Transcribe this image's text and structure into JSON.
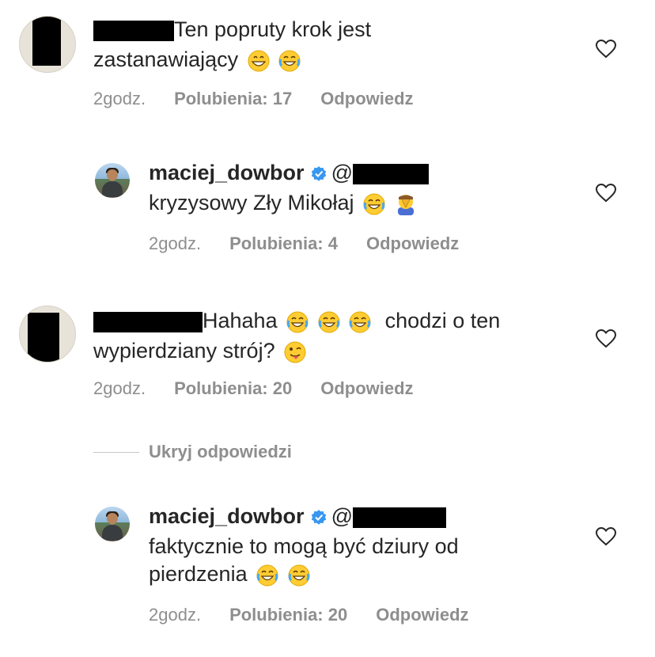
{
  "comments": [
    {
      "text1": "Ten popruty krok jest",
      "text2": "zastanawiający",
      "emojis": [
        "grinning-face",
        "face-with-tears-of-joy"
      ],
      "meta": {
        "time": "2godz.",
        "likes": "Polubienia: 17",
        "reply": "Odpowiedz"
      }
    },
    {
      "username": "maciej_dowbor",
      "mention": "@",
      "text1": "kryzysowy Zły Mikołaj",
      "emojis": [
        "face-with-tears-of-joy",
        "man-facepalming"
      ],
      "meta": {
        "time": "2godz.",
        "likes": "Polubienia: 4",
        "reply": "Odpowiedz"
      }
    },
    {
      "text1a": "Hahaha",
      "text1b": "chodzi o ten",
      "text2": "wypierdziany strój?",
      "emojis1": [
        "face-with-tears-of-joy",
        "face-with-tears-of-joy",
        "face-with-tears-of-joy"
      ],
      "emojis2": [
        "winking-face-with-tongue"
      ],
      "meta": {
        "time": "2godz.",
        "likes": "Polubienia: 20",
        "reply": "Odpowiedz"
      }
    },
    {
      "username": "maciej_dowbor",
      "mention": "@",
      "text1": "faktycznie to mogą być dziury od",
      "text2": "pierdzenia",
      "emojis": [
        "face-with-tears-of-joy",
        "face-with-tears-of-joy"
      ],
      "meta": {
        "time": "2godz.",
        "likes": "Polubienia: 20",
        "reply": "Odpowiedz"
      }
    }
  ],
  "hide_replies": "Ukryj odpowiedzi",
  "colors": {
    "text": "#262626",
    "meta": "#8e8e8e",
    "verified": "#3897f0",
    "background": "#ffffff"
  }
}
